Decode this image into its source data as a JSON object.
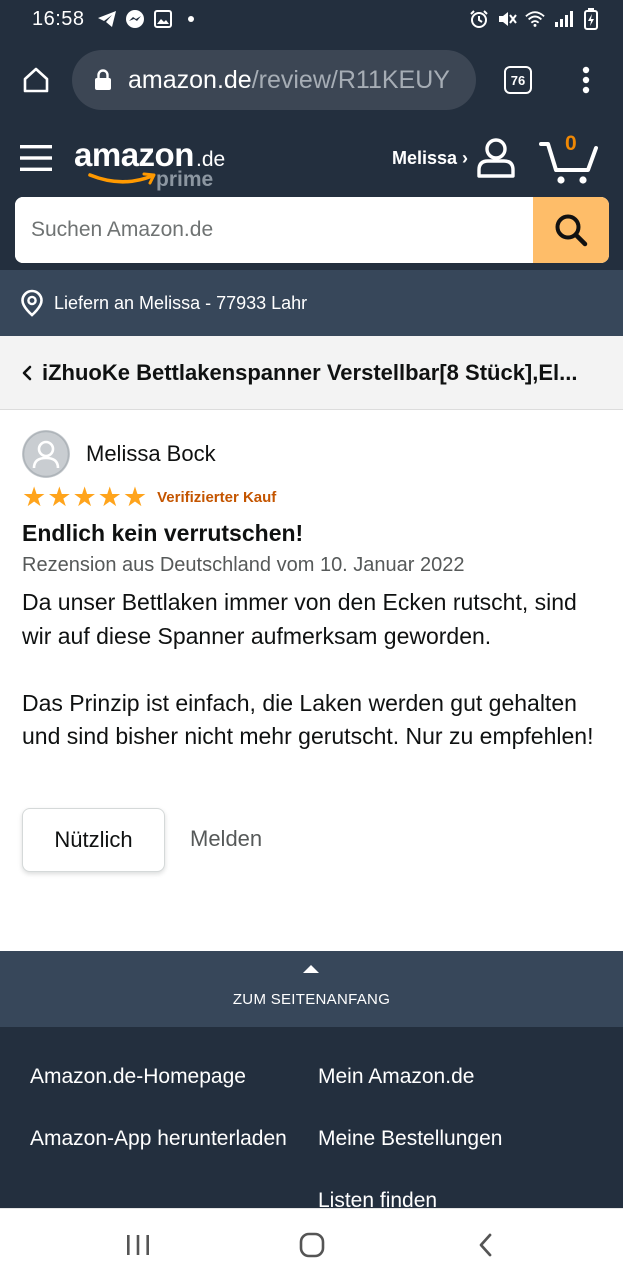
{
  "status_bar": {
    "time": "16:58",
    "left_icons": [
      "telegram-icon",
      "messenger-icon",
      "gallery-icon",
      "dot-icon"
    ],
    "right_icons": [
      "alarm-icon",
      "mute-icon",
      "wifi-icon",
      "signal-icon",
      "battery-icon"
    ]
  },
  "browser": {
    "url_host": "amazon.de",
    "url_path": "/review/R11KEUY",
    "tab_count": "76"
  },
  "header": {
    "logo_word": "amazon",
    "logo_domain": ".de",
    "logo_prime": "prime",
    "account_label": "Melissa ›",
    "cart_count": "0"
  },
  "search": {
    "placeholder": "Suchen Amazon.de"
  },
  "deliver": {
    "text": "Liefern an Melissa - 77933 Lahr"
  },
  "product": {
    "title": "iZhuoKe Bettlakenspanner Verstellbar[8 Stück],El..."
  },
  "review": {
    "reviewer_name": "Melissa Bock",
    "rating": 5,
    "rating_max": 5,
    "verified_label": "Verifizierter Kauf",
    "title": "Endlich kein verrutschen!",
    "meta": "Rezension aus Deutschland vom 10. Januar 2022",
    "body_p1": "Da unser Bettlaken immer von den Ecken rutscht, sind wir auf diese Spanner aufmerksam geworden.",
    "body_p2": "Das Prinzip ist einfach, die Laken werden gut gehalten und sind bisher nicht mehr gerutscht. Nur zu empfehlen!",
    "helpful_label": "Nützlich",
    "report_label": "Melden"
  },
  "back_to_top": {
    "label": "ZUM SEITENANFANG"
  },
  "footer": {
    "left_links": [
      "Amazon.de-Homepage",
      "Amazon-App herunterladen"
    ],
    "right_links": [
      "Mein Amazon.de",
      "Meine Bestellungen",
      "Listen finden"
    ]
  },
  "colors": {
    "header_bg": "#232f3e",
    "subheader_bg": "#37475a",
    "search_button": "#febd69",
    "star": "#ffa41c",
    "verified": "#c45500",
    "cart_count": "#f08804"
  }
}
